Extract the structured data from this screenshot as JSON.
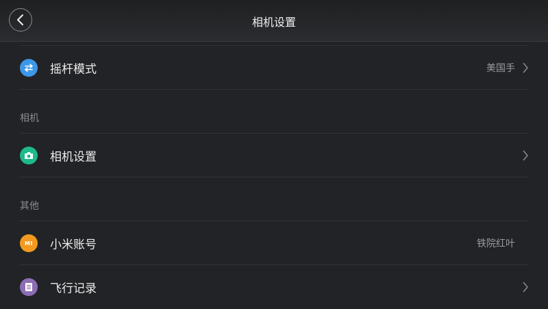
{
  "header": {
    "title": "相机设置",
    "back_icon": "chevron-left-icon"
  },
  "rows": [
    {
      "label": "摇杆模式",
      "value": "美国手",
      "icon": "swap-arrows-icon",
      "icon_color": "#3d97e8",
      "has_chevron": true
    },
    {
      "label": "相机设置",
      "value": "",
      "icon": "camera-icon",
      "icon_color": "#1dba8a",
      "has_chevron": true
    },
    {
      "label": "小米账号",
      "value": "铁院红叶",
      "icon": "mi-logo-icon",
      "icon_color": "#f39a1e",
      "has_chevron": false
    },
    {
      "label": "飞行记录",
      "value": "",
      "icon": "document-icon",
      "icon_color": "#8c6db3",
      "has_chevron": true
    }
  ],
  "sections": [
    {
      "title": "相机"
    },
    {
      "title": "其他"
    }
  ],
  "mi_logo_text": "MI"
}
